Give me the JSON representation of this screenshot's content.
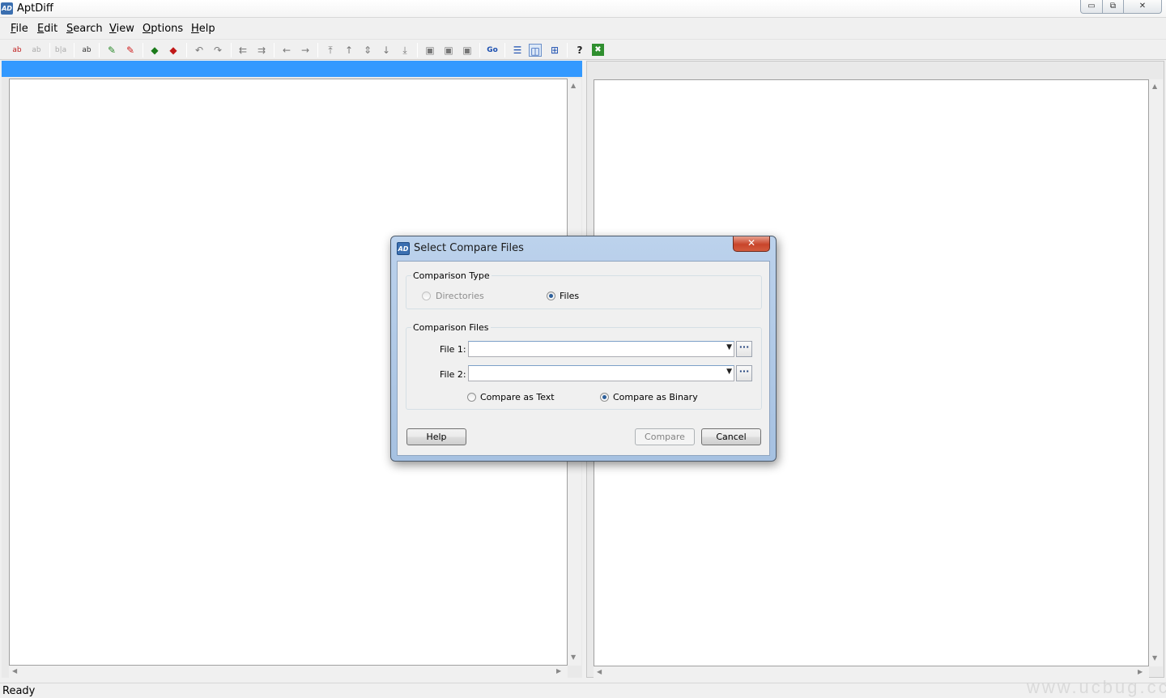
{
  "window": {
    "title": "AptDiff",
    "icon_text": "AD",
    "controls": {
      "minimize": "▭",
      "maximize": "⧉",
      "close": "✕"
    }
  },
  "menu": [
    {
      "mnemonic": "F",
      "rest": "ile"
    },
    {
      "mnemonic": "E",
      "rest": "dit"
    },
    {
      "mnemonic": "S",
      "rest": "earch"
    },
    {
      "mnemonic": "V",
      "rest": "iew"
    },
    {
      "mnemonic": "O",
      "rest": "ptions"
    },
    {
      "mnemonic": "H",
      "rest": "elp"
    }
  ],
  "toolbar": {
    "icons": [
      "compare-icon",
      "recompare-icon",
      "swap-icon",
      "spellcheck-icon",
      "edit-left-icon",
      "edit-right-icon",
      "copy-left-icon",
      "copy-right-icon",
      "undo-icon",
      "redo-icon",
      "merge-left-icon",
      "merge-right-icon",
      "prev-icon",
      "next-icon",
      "first-diff-icon",
      "prev-diff-icon",
      "current-diff-icon",
      "next-diff-icon",
      "last-diff-icon",
      "save-left-icon",
      "save-right-icon",
      "save-all-icon",
      "goto-icon",
      "horizontal-layout-icon",
      "vertical-layout-icon",
      "split-layout-icon",
      "help-icon",
      "exit-icon"
    ]
  },
  "status": {
    "text": "Ready"
  },
  "watermark": "www.ucbug.cc",
  "dialog": {
    "title": "Select Compare Files",
    "icon_text": "AD",
    "close_glyph": "✕",
    "comparison_type": {
      "label": "Comparison Type",
      "options": [
        {
          "label": "Directories",
          "checked": false,
          "disabled": true
        },
        {
          "label": "Files",
          "checked": true,
          "disabled": false
        }
      ]
    },
    "comparison_files": {
      "label": "Comparison Files",
      "file1_label": "File 1:",
      "file1_value": "",
      "file2_label": "File 2:",
      "file2_value": "",
      "browse_label": "···",
      "modes": [
        {
          "label": "Compare as Text",
          "checked": false
        },
        {
          "label": "Compare as Binary",
          "checked": true
        }
      ]
    },
    "buttons": {
      "help": "Help",
      "compare": "Compare",
      "cancel": "Cancel"
    }
  }
}
